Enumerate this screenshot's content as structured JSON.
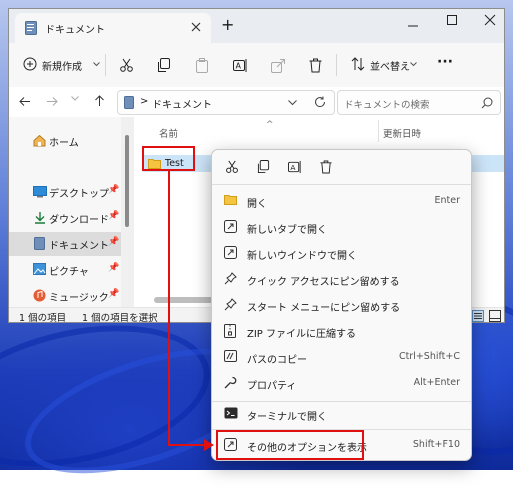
{
  "window": {
    "tab_title": "ドキュメント",
    "new_tab_glyph": "+"
  },
  "commandbar": {
    "new_label": "新規作成",
    "sort_label": "並べ替え",
    "more_glyph": "···"
  },
  "address": {
    "chevron": ">",
    "location": "ドキュメント",
    "search_placeholder": "ドキュメントの検索"
  },
  "nav": {
    "items": [
      {
        "label": "ホーム",
        "icon": "home-icon"
      },
      {
        "label": "デスクトップ",
        "icon": "desktop-icon"
      },
      {
        "label": "ダウンロード",
        "icon": "download-icon"
      },
      {
        "label": "ドキュメント",
        "icon": "documents-icon"
      },
      {
        "label": "ピクチャ",
        "icon": "pictures-icon"
      },
      {
        "label": "ミュージック",
        "icon": "music-icon"
      }
    ]
  },
  "content": {
    "col_name": "名前",
    "col_modified": "更新日時",
    "sort_glyph": "^",
    "folder_name": "Test"
  },
  "status": {
    "item_count": "1 個の項目",
    "selected_count": "1 個の項目を選択"
  },
  "context_menu": {
    "items": [
      {
        "label": "開く",
        "key": "Enter",
        "icon": "folder-open-icon"
      },
      {
        "label": "新しいタブで開く",
        "key": "",
        "icon": "new-tab-icon"
      },
      {
        "label": "新しいウインドウで開く",
        "key": "",
        "icon": "new-window-icon"
      },
      {
        "label": "クイック アクセスにピン留めする",
        "key": "",
        "icon": "pin-icon"
      },
      {
        "label": "スタート メニューにピン留めする",
        "key": "",
        "icon": "pin-icon"
      },
      {
        "label": "ZIP ファイルに圧縮する",
        "key": "",
        "icon": "zip-icon"
      },
      {
        "label": "パスのコピー",
        "key": "Ctrl+Shift+C",
        "icon": "copy-path-icon"
      },
      {
        "label": "プロパティ",
        "key": "Alt+Enter",
        "icon": "wrench-icon"
      },
      {
        "label": "ターミナルで開く",
        "key": "",
        "icon": "terminal-icon"
      },
      {
        "label": "その他のオプションを表示",
        "key": "Shift+F10",
        "icon": "more-options-icon"
      }
    ]
  },
  "colors": {
    "accent": "#0067c0",
    "annotation_red": "#e01010",
    "folder_yellow": "#f5c542"
  }
}
